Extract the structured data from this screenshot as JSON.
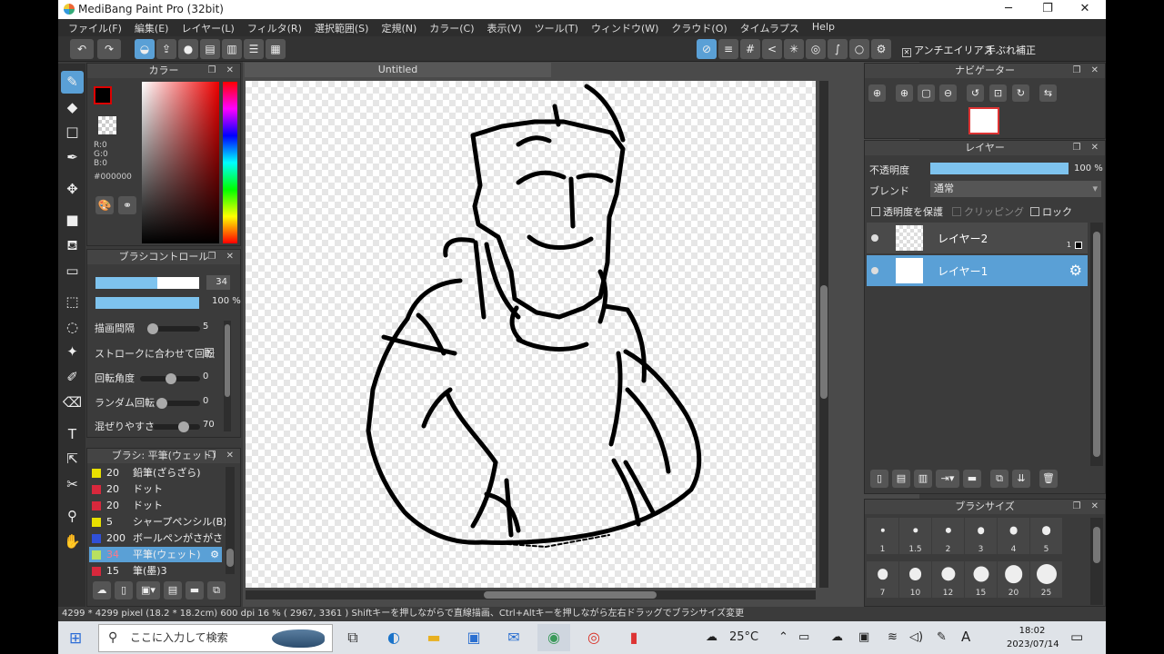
{
  "app": {
    "title": "MediBang Paint Pro (32bit)",
    "min": "─",
    "max": "❐",
    "close": "✕"
  },
  "menu": [
    "ファイル(F)",
    "編集(E)",
    "レイヤー(L)",
    "フィルタ(R)",
    "選択範囲(S)",
    "定規(N)",
    "カラー(C)",
    "表示(V)",
    "ツール(T)",
    "ウィンドウ(W)",
    "クラウド(O)",
    "タイムラプス",
    "Help"
  ],
  "toolbar": {
    "antialias": "アンチエイリアス",
    "stabilizer": "手ぶれ補正"
  },
  "color_panel": {
    "title": "カラー",
    "r": "R:0",
    "g": "G:0",
    "b": "B:0",
    "hex": "#000000",
    "icons": "❐ ✕"
  },
  "brush_control": {
    "title": "ブラシコントロール",
    "size": "34",
    "size_fraction": 0.6,
    "opacity": "100 %",
    "opacity_fraction": 1.0,
    "spacing_label": "描画間隔",
    "spacing": "5",
    "rotate_stroke_label": "ストロークに合わせて回転",
    "rotate_stroke_mark": "✕",
    "angle_label": "回転角度",
    "angle": "0",
    "random_label": "ランダム回転",
    "random": "0",
    "mix_label": "混ぜりやすさ",
    "mix": "70"
  },
  "brush_list": {
    "title": "ブラシ: 平筆(ウェット)",
    "items": [
      {
        "size": "20",
        "name": "鉛筆(ざらざら)",
        "color": "#e8e000"
      },
      {
        "size": "20",
        "name": "ドット",
        "color": "#d8283c"
      },
      {
        "size": "20",
        "name": "ドット",
        "color": "#d8283c"
      },
      {
        "size": "5",
        "name": "シャープペンシル(B)",
        "color": "#e8e000"
      },
      {
        "size": "200",
        "name": "ボールペンがさがさ",
        "color": "#3050d8"
      },
      {
        "size": "34",
        "name": "平筆(ウェット)",
        "color": "#b8e060"
      },
      {
        "size": "15",
        "name": "筆(墨)3",
        "color": "#d8283c"
      }
    ]
  },
  "document": {
    "title": "Untitled"
  },
  "navigator": {
    "title": "ナビゲーター"
  },
  "layers": {
    "title": "レイヤー",
    "opacity_label": "不透明度",
    "opacity": "100 %",
    "opacity_fraction": 1.0,
    "blend_label": "ブレンド",
    "blend": "通常",
    "protect": "透明度を保護",
    "clipping": "クリッピング",
    "lock": "ロック",
    "items": [
      {
        "name": "レイヤー2",
        "badge": "1"
      },
      {
        "name": "レイヤー1"
      }
    ]
  },
  "brush_size": {
    "title": "ブラシサイズ",
    "sizes": [
      "1",
      "1.5",
      "2",
      "3",
      "4",
      "5",
      "7",
      "10",
      "12",
      "15",
      "20",
      "25"
    ]
  },
  "status": {
    "text": "4299 * 4299 pixel  (18.2 * 18.2cm)  600 dpi  16 %  ( 2967, 3361 )  Shiftキーを押しながらで直線描画、Ctrl+Altキーを押しながら左右ドラッグでブラシサイズ変更"
  },
  "taskbar": {
    "search_placeholder": "ここに入力して検索",
    "weather": "25°C",
    "ime": "A",
    "time": "18:02",
    "date": "2023/07/14"
  }
}
